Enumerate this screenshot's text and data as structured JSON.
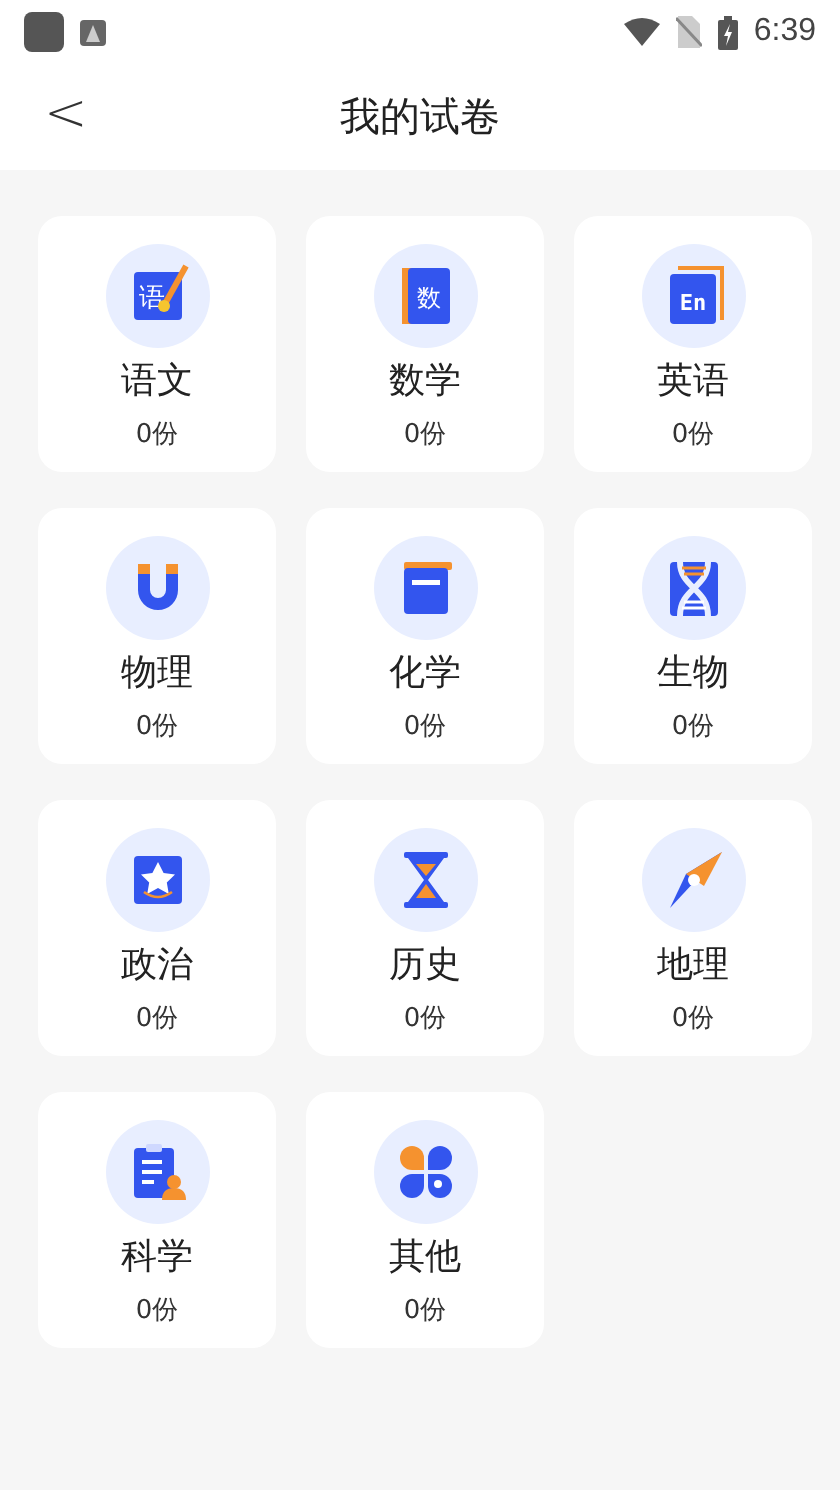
{
  "status_bar": {
    "time": "6:39"
  },
  "header": {
    "back": "<",
    "title": "我的试卷"
  },
  "subjects": [
    {
      "kind": "chinese",
      "icon_text": "语",
      "name": "语文",
      "count": "0份"
    },
    {
      "kind": "math",
      "icon_text": "数",
      "name": "数学",
      "count": "0份"
    },
    {
      "kind": "english",
      "icon_text": "En",
      "name": "英语",
      "count": "0份"
    },
    {
      "kind": "physics",
      "name": "物理",
      "count": "0份"
    },
    {
      "kind": "chemistry",
      "name": "化学",
      "count": "0份"
    },
    {
      "kind": "biology",
      "name": "生物",
      "count": "0份"
    },
    {
      "kind": "politics",
      "name": "政治",
      "count": "0份"
    },
    {
      "kind": "history",
      "name": "历史",
      "count": "0份"
    },
    {
      "kind": "geography",
      "name": "地理",
      "count": "0份"
    },
    {
      "kind": "science",
      "name": "科学",
      "count": "0份"
    },
    {
      "kind": "other",
      "name": "其他",
      "count": "0份"
    }
  ]
}
